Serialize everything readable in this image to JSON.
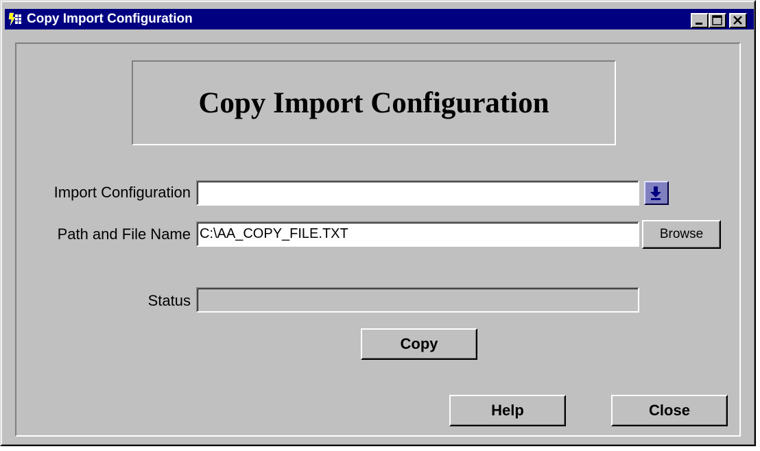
{
  "window": {
    "title": "Copy Import Configuration",
    "icon": "app-lightning-icon",
    "controls": [
      "minimize-icon",
      "maximize-icon",
      "close-icon"
    ]
  },
  "banner": {
    "title": "Copy Import Configuration"
  },
  "form": {
    "import_configuration": {
      "label": "Import Configuration",
      "value": "",
      "dropdown_icon": "download-arrow-icon"
    },
    "path_and_file_name": {
      "label": "Path and File Name",
      "value": "C:\\AA_COPY_FILE.TXT",
      "browse_label": "Browse"
    },
    "status": {
      "label": "Status",
      "value": ""
    }
  },
  "buttons": {
    "copy": "Copy",
    "help": "Help",
    "close": "Close"
  },
  "colors": {
    "titlebar": "#000080",
    "face": "#c0c0c0",
    "dropdown_accent": "#8080c0"
  }
}
